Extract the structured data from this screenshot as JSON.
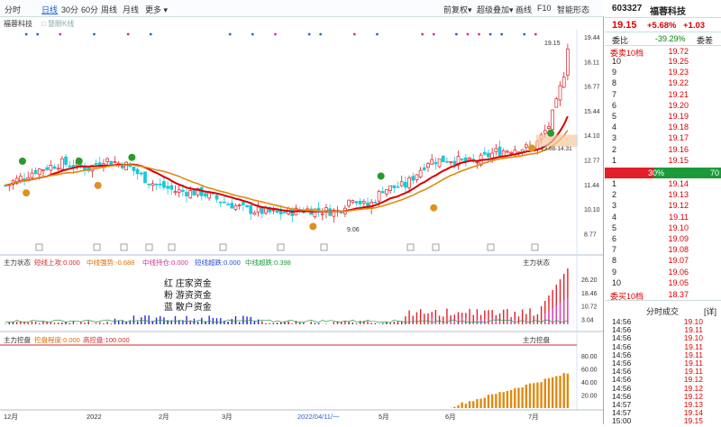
{
  "toolbar": {
    "left": [
      "分时",
      "日线",
      "30分",
      "60分",
      "周线",
      "月线",
      "更多 ▾"
    ],
    "right": [
      "前复权▾",
      "超级叠加▾",
      "画线",
      "F10",
      "智能形态"
    ]
  },
  "tabs": {
    "stock": "福蓉科技",
    "ghost": "□ 慧眼K线"
  },
  "kline": {
    "high_label": "19.15",
    "low_label": "9.06",
    "range_label": "13.68-14.31",
    "y_ticks": [
      "19.44",
      "18.11",
      "16.77",
      "15.44",
      "14.10",
      "12.77",
      "11.44",
      "10.10",
      "8.77"
    ]
  },
  "panel2": {
    "title": "主力状态",
    "title_r": "主力状态",
    "items": [
      {
        "text": "短线上攻:0.000",
        "color": "#d02a2a"
      },
      {
        "text": "中线强势:-0.688",
        "color": "#e06f00"
      },
      {
        "text": "中线持仓:0.000",
        "color": "#d0309a"
      },
      {
        "text": "短线超跌:0.000",
        "color": "#2a4fd0"
      },
      {
        "text": "中线超跌:0.398",
        "color": "#1c9a3a"
      }
    ],
    "annotations": [
      "红 庄家资金",
      "粉 游资资金",
      "蓝 散户资金"
    ],
    "y_ticks": [
      "26.20",
      "18.46",
      "10.72",
      "3.04"
    ]
  },
  "panel3": {
    "title": "主力控盘",
    "title_r": "主力控盘",
    "items": [
      {
        "text": "控盘程度:0.000",
        "color": "#e06f00"
      },
      {
        "text": "高控盘:100.000",
        "color": "#d02a2a"
      }
    ],
    "y_ticks": [
      "80.00",
      "60.00",
      "40.00",
      "20.00"
    ]
  },
  "xaxis": [
    "12月",
    "2022",
    "2月",
    "3月",
    "2022/04/11/一",
    "5月",
    "6月",
    "7月"
  ],
  "quote": {
    "code": "603327",
    "name": "福蓉科技",
    "price": "19.15",
    "pct": "+5.68%",
    "chg": "+1.03",
    "ratio_label": "委比",
    "ratio": "-39.29%",
    "diff_label": "委差",
    "sell_top_label": "委卖10档",
    "sell_top": "19.72",
    "buy_bottom_label": "委买10档",
    "buy_bottom": "18.37",
    "bar_left": "30%",
    "bar_right": "70",
    "sells": [
      [
        "10",
        "19.25"
      ],
      [
        "9",
        "19.23"
      ],
      [
        "8",
        "19.22"
      ],
      [
        "7",
        "19.21"
      ],
      [
        "6",
        "19.20"
      ],
      [
        "5",
        "19.19"
      ],
      [
        "4",
        "19.18"
      ],
      [
        "3",
        "19.17"
      ],
      [
        "2",
        "19.16"
      ],
      [
        "1",
        "19.15"
      ]
    ],
    "buys": [
      [
        "1",
        "19.14"
      ],
      [
        "2",
        "19.13"
      ],
      [
        "3",
        "19.12"
      ],
      [
        "4",
        "19.11"
      ],
      [
        "5",
        "19.10"
      ],
      [
        "6",
        "19.09"
      ],
      [
        "7",
        "19.08"
      ],
      [
        "8",
        "19.07"
      ],
      [
        "9",
        "19.06"
      ],
      [
        "10",
        "19.05"
      ]
    ],
    "trades_title": "分时成交",
    "trades_btn": "[详]",
    "trades": [
      [
        "14:56",
        "19.10"
      ],
      [
        "14:56",
        "19.11"
      ],
      [
        "14:56",
        "19.10"
      ],
      [
        "14:56",
        "19.11"
      ],
      [
        "14:56",
        "19.11"
      ],
      [
        "14:56",
        "19.11"
      ],
      [
        "14:56",
        "19.11"
      ],
      [
        "14:56",
        "19.12"
      ],
      [
        "14:56",
        "19.12"
      ],
      [
        "14:56",
        "19.12"
      ],
      [
        "14:57",
        "19.13"
      ],
      [
        "14:57",
        "19.14"
      ],
      [
        "15:00",
        "19.15"
      ]
    ]
  },
  "colors": {
    "up": "#e0202a",
    "down": "#18c8d8",
    "ma1": "#d80000",
    "ma2": "#e08a10"
  }
}
